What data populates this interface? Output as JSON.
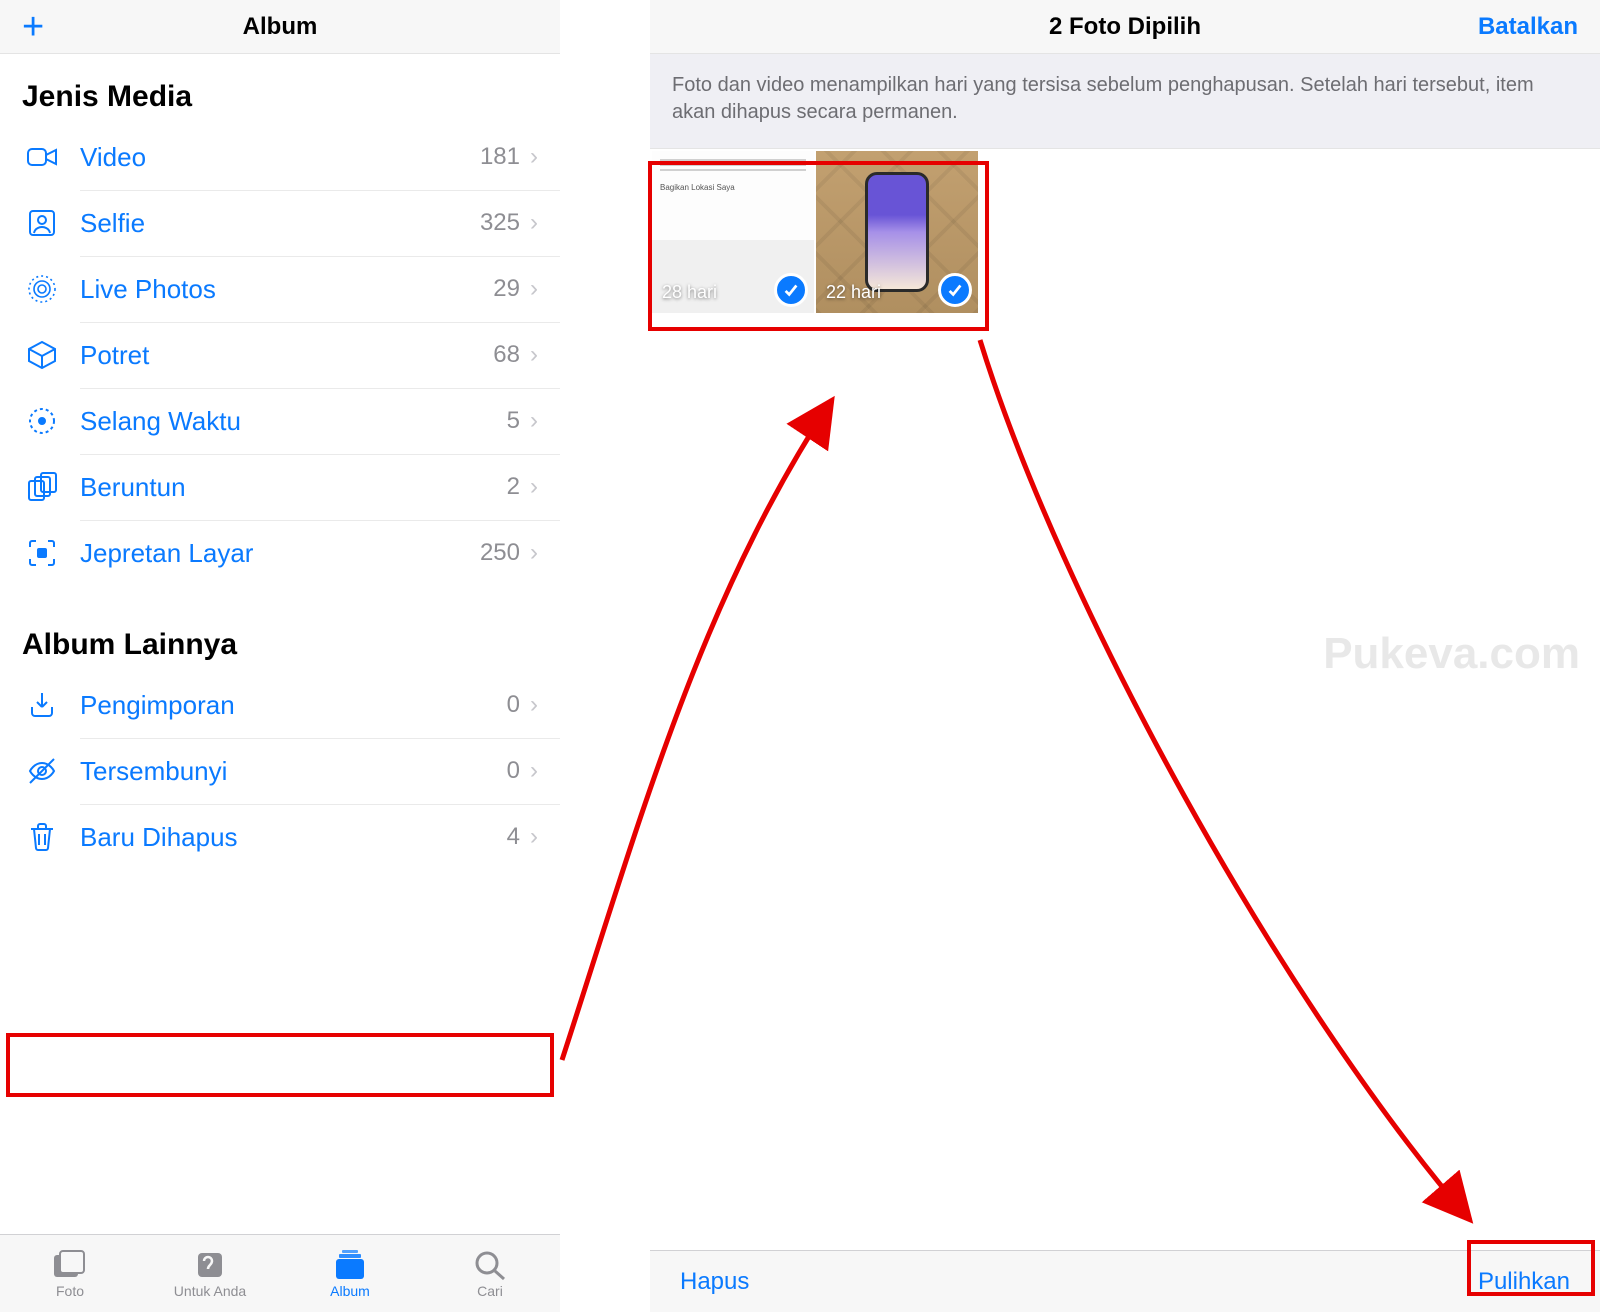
{
  "left": {
    "header_title": "Album",
    "section_media_title": "Jenis Media",
    "media_rows": [
      {
        "icon": "video",
        "label": "Video",
        "count": "181"
      },
      {
        "icon": "selfie",
        "label": "Selfie",
        "count": "325"
      },
      {
        "icon": "live",
        "label": "Live Photos",
        "count": "29"
      },
      {
        "icon": "cube",
        "label": "Potret",
        "count": "68"
      },
      {
        "icon": "timelapse",
        "label": "Selang Waktu",
        "count": "5"
      },
      {
        "icon": "burst",
        "label": "Beruntun",
        "count": "2"
      },
      {
        "icon": "screenshot",
        "label": "Jepretan Layar",
        "count": "250"
      }
    ],
    "section_other_title": "Album Lainnya",
    "other_rows": [
      {
        "icon": "import",
        "label": "Pengimporan",
        "count": "0"
      },
      {
        "icon": "hidden",
        "label": "Tersembunyi",
        "count": "0"
      },
      {
        "icon": "trash",
        "label": "Baru Dihapus",
        "count": "4"
      }
    ],
    "tabs": [
      {
        "label": "Foto"
      },
      {
        "label": "Untuk Anda"
      },
      {
        "label": "Album",
        "active": true
      },
      {
        "label": "Cari"
      }
    ]
  },
  "right": {
    "header_title": "2 Foto Dipilih",
    "cancel": "Batalkan",
    "info": "Foto dan video menampilkan hari yang tersisa sebelum penghapusan. Setelah hari tersebut, item akan dihapus secara permanen.",
    "thumbs": [
      {
        "days": "28 hari",
        "fake_text": "Bagikan Lokasi Saya"
      },
      {
        "days": "22 hari"
      }
    ],
    "delete": "Hapus",
    "recover": "Pulihkan"
  },
  "watermark": "Pukeva.com"
}
